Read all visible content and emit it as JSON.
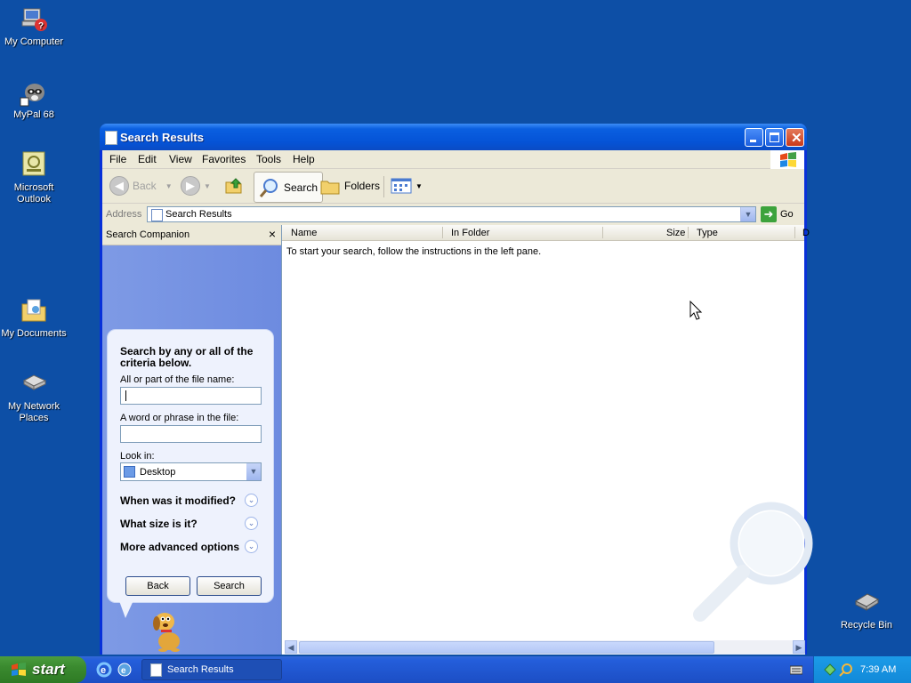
{
  "desktop": {
    "icons": [
      {
        "label": "My Computer",
        "icon": "my-computer-icon"
      },
      {
        "label": "MyPal 68",
        "icon": "raccoon-icon"
      },
      {
        "label": "Microsoft Outlook",
        "icon": "outlook-icon"
      },
      {
        "label": "My Documents",
        "icon": "my-documents-icon"
      },
      {
        "label": "My Network Places",
        "icon": "network-places-icon"
      },
      {
        "label": "Recycle Bin",
        "icon": "recycle-bin-icon"
      }
    ]
  },
  "window": {
    "title": "Search Results",
    "menu": [
      "File",
      "Edit",
      "View",
      "Favorites",
      "Tools",
      "Help"
    ],
    "toolbar": {
      "back": "Back",
      "search": "Search",
      "folders": "Folders"
    },
    "address": {
      "label": "Address",
      "value": "Search Results",
      "go": "Go"
    }
  },
  "companion": {
    "title": "Search Companion",
    "close": "×",
    "heading": "Search by any or all of the criteria below.",
    "filename_label": "All or part of the file name:",
    "filename_value": "",
    "phrase_label": "A word or phrase in the file:",
    "phrase_value": "",
    "lookin_label": "Look in:",
    "lookin_value": "Desktop",
    "options": [
      "When was it modified?",
      "What size is it?",
      "More advanced options"
    ],
    "back_button": "Back",
    "search_button": "Search"
  },
  "results": {
    "columns": [
      "Name",
      "In Folder",
      "Size",
      "Type",
      "D"
    ],
    "empty_message": "To start your search, follow the instructions in the left pane."
  },
  "taskbar": {
    "start": "start",
    "task": "Search Results",
    "clock": "7:39 AM"
  },
  "colors": {
    "desktop": "#0d4fa6",
    "titlebar": "#0553d6",
    "companion": "#7e9ae5"
  }
}
